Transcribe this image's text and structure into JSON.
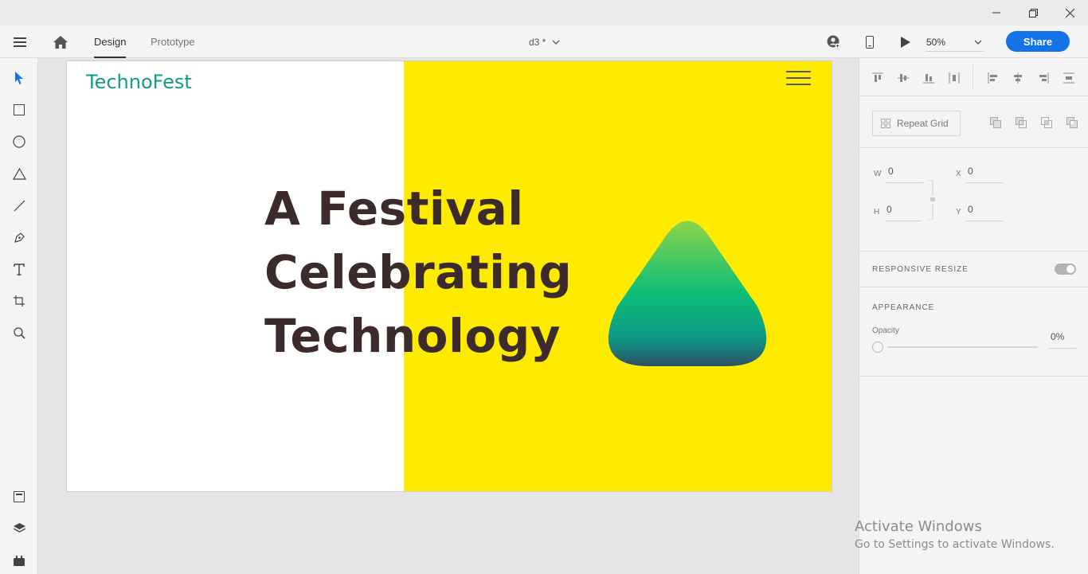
{
  "window": {
    "minimize": "minimize",
    "restore": "restore",
    "close": "close"
  },
  "appbar": {
    "tabs": [
      {
        "label": "Design",
        "active": true
      },
      {
        "label": "Prototype",
        "active": false
      }
    ],
    "document_name": "d3 *",
    "zoom": "50%",
    "share_label": "Share"
  },
  "left_tools": [
    "select-icon",
    "rectangle-icon",
    "ellipse-icon",
    "triangle-icon",
    "line-icon",
    "pen-icon",
    "text-icon",
    "artboard-icon",
    "zoom-icon",
    "assets-icon",
    "layers-icon",
    "plugins-icon"
  ],
  "artboard": {
    "brand": "TechnoFest",
    "headline": [
      "A Festival",
      "Celebrating",
      "Technology"
    ],
    "colors": {
      "yellow": "#ffeb00",
      "headline": "#3d2b2b",
      "brand": "#129b8b",
      "blob_top": "#8ad54a",
      "blob_mid": "#0dbd78",
      "blob_bottom": "#2f4f63"
    }
  },
  "right_panel": {
    "repeat_grid_label": "Repeat Grid",
    "dimensions": {
      "w_label": "W",
      "w_value": "0",
      "h_label": "H",
      "h_value": "0",
      "x_label": "X",
      "x_value": "0",
      "y_label": "Y",
      "y_value": "0"
    },
    "responsive_resize_title": "RESPONSIVE RESIZE",
    "appearance_title": "APPEARANCE",
    "opacity_label": "Opacity",
    "opacity_value": "0%"
  },
  "watermark": {
    "line1": "Activate Windows",
    "line2": "Go to Settings to activate Windows."
  }
}
